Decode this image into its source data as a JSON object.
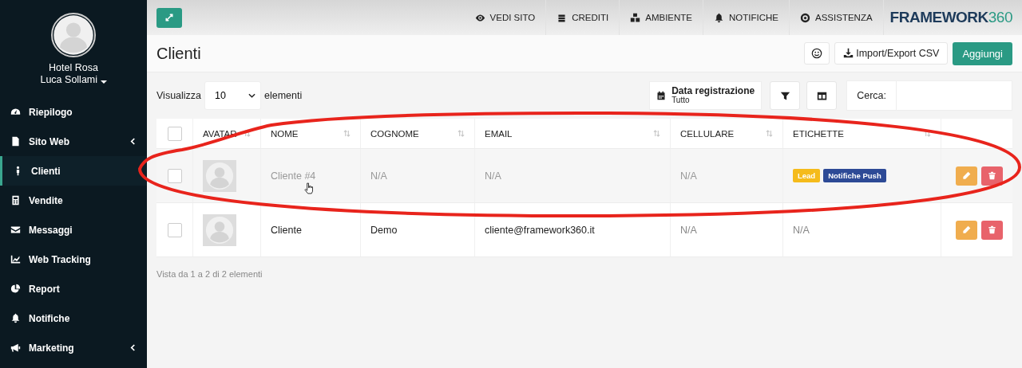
{
  "sidebar": {
    "account": "Hotel Rosa",
    "user": "Luca Sollami",
    "items": [
      {
        "label": "Riepilogo",
        "expandable": false,
        "selected": false
      },
      {
        "label": "Sito Web",
        "expandable": true,
        "selected": false
      },
      {
        "label": "Clienti",
        "expandable": false,
        "selected": true
      },
      {
        "label": "Vendite",
        "expandable": false,
        "selected": false
      },
      {
        "label": "Messaggi",
        "expandable": false,
        "selected": false
      },
      {
        "label": "Web Tracking",
        "expandable": false,
        "selected": false
      },
      {
        "label": "Report",
        "expandable": false,
        "selected": false
      },
      {
        "label": "Notifiche",
        "expandable": false,
        "selected": false
      },
      {
        "label": "Marketing",
        "expandable": true,
        "selected": false
      }
    ]
  },
  "topbar": {
    "links": [
      "VEDI SITO",
      "CREDITI",
      "AMBIENTE",
      "NOTIFICHE",
      "ASSISTENZA"
    ],
    "logo": {
      "word": "FRAMEWORK",
      "number": "360"
    }
  },
  "page": {
    "title": "Clienti",
    "buttons": [
      {
        "label": "Import/Export CSV",
        "kind": "import"
      },
      {
        "label": "Aggiungi",
        "kind": "primary"
      }
    ]
  },
  "toolbar": {
    "show_label": "Visualizza",
    "page_size": "10",
    "show_suffix": "elementi",
    "date_filter": {
      "label": "Data registrazione",
      "value": "Tutto"
    },
    "search_label": "Cerca:"
  },
  "table": {
    "select_all_checked": false,
    "columns": [
      {
        "label": "AVATAR",
        "sortable": true
      },
      {
        "label": "NOME",
        "sortable": true
      },
      {
        "label": "COGNOME",
        "sortable": true
      },
      {
        "label": "EMAIL",
        "sortable": true
      },
      {
        "label": "CELLULARE",
        "sortable": true
      },
      {
        "label": "ETICHETTE",
        "sortable": true
      }
    ],
    "rows": [
      {
        "nome": "Cliente #4",
        "cognome": "N/A",
        "email": "N/A",
        "cellulare": "N/A",
        "tags": [
          {
            "label": "Lead",
            "color": "#f5bb1b"
          },
          {
            "label": "Notifiche Push",
            "color": "#2d4a96"
          }
        ],
        "empty_tags": "",
        "hovered": true,
        "checked": false
      },
      {
        "nome": "Cliente",
        "cognome": "Demo",
        "email": "cliente@framework360.it",
        "cellulare": "N/A",
        "tags": [],
        "empty_tags": "N/A",
        "hovered": false,
        "checked": false
      }
    ],
    "footer": "Vista da 1 a 2 di 2 elementi"
  },
  "annotation": {
    "kind": "ellipse"
  }
}
